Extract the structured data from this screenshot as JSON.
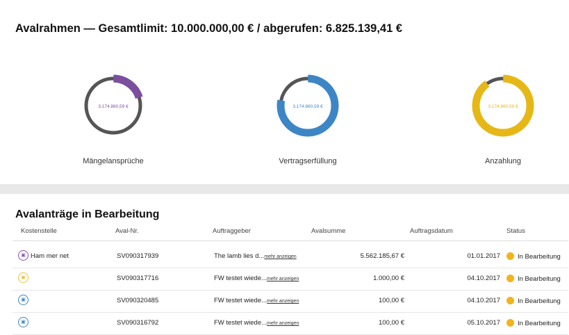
{
  "header": {
    "headline": "Avalrahmen — Gesamtlimit:  10.000.000,00 €  /  abgerufen:  6.825.139,41 €"
  },
  "donuts": [
    {
      "label": "Mängelansprüche",
      "center_value": "3.174.860,59 €",
      "color": "#7b4f9e",
      "fraction": 0.2,
      "track_color": "#555555"
    },
    {
      "label": "Vertragserfüllung",
      "center_value": "3.174.860,59 €",
      "color": "#3d86c6",
      "fraction": 0.78,
      "track_color": "#555555"
    },
    {
      "label": "Anzahlung",
      "center_value": "3.174.860,59 €",
      "color": "#e6b817",
      "fraction": 0.9,
      "track_color": "#555555"
    }
  ],
  "section": {
    "title": "Avalanträge in Bearbeitung",
    "columns": [
      "Kostenstelle",
      "Aval-Nr.",
      "Auftraggeber",
      "Avalsumme",
      "Auftragsdatum",
      "Status"
    ]
  },
  "more_label": "mehr anzeigen",
  "rows": [
    {
      "icon_color": "#8b4fb0",
      "kostenstelle": "Ham mer net",
      "aval_nr": "SV090317939",
      "auftraggeber": "The lamb lies d...",
      "avalsumme": "5.562.185,67 €",
      "datum": "01.01.2017",
      "status": "In Bearbeitung"
    },
    {
      "icon_color": "#e6c33a",
      "kostenstelle": "",
      "aval_nr": "SV090317716",
      "auftraggeber": "FW testet wiede...",
      "avalsumme": "1.000,00 €",
      "datum": "04.10.2017",
      "status": "In Bearbeitung"
    },
    {
      "icon_color": "#3d86c6",
      "kostenstelle": "",
      "aval_nr": "SV090320485",
      "auftraggeber": "FW testet wiede...",
      "avalsumme": "100,00 €",
      "datum": "04.10.2017",
      "status": "In Bearbeitung"
    },
    {
      "icon_color": "#3d86c6",
      "kostenstelle": "",
      "aval_nr": "SV090316792",
      "auftraggeber": "FW testet wiede...",
      "avalsumme": "100,00 €",
      "datum": "05.10.2017",
      "status": "In Bearbeitung"
    }
  ],
  "status_color": "#f3b31a",
  "icon_name": "document-icon"
}
